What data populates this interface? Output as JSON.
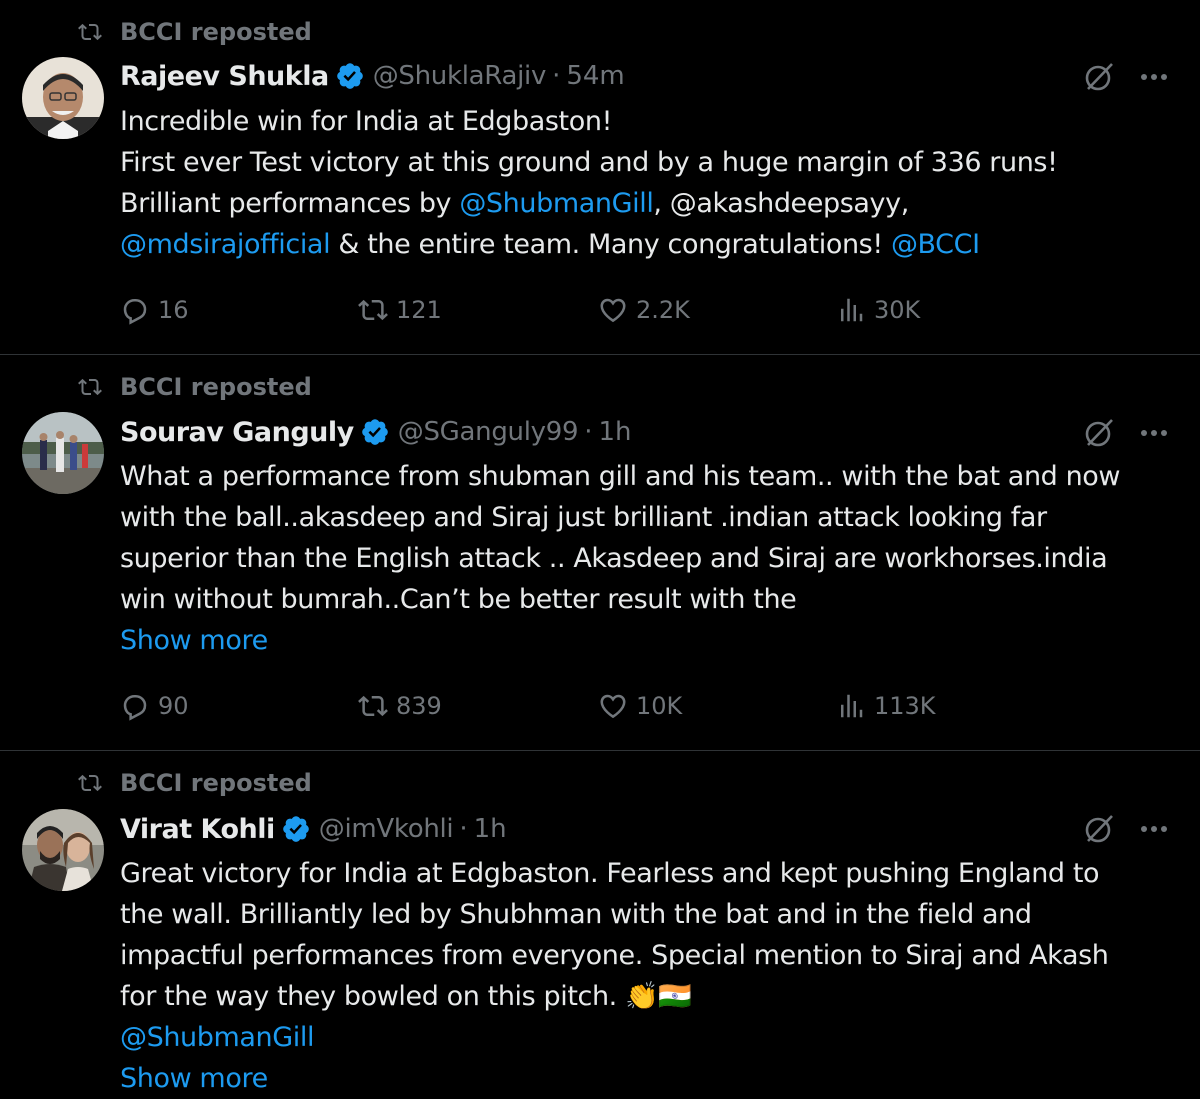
{
  "tweets": [
    {
      "repost_label": "BCCI reposted",
      "name": "Rajeev Shukla",
      "handle": "@ShuklaRajiv",
      "separator": "·",
      "time": "54m",
      "text_lines": [
        [
          {
            "t": "Incredible win for India at Edgbaston!"
          }
        ],
        [
          {
            "t": "First ever Test victory at this ground and by a huge margin of 336 runs!"
          }
        ],
        [
          {
            "t": "Brilliant performances by "
          },
          {
            "t": "@ShubmanGill",
            "link": true
          },
          {
            "t": ", @akashdeepsayy,"
          }
        ],
        [
          {
            "t": "@mdsirajofficial",
            "link": true
          },
          {
            "t": " & the entire team. Many congratulations! "
          },
          {
            "t": "@BCCI",
            "link": true
          }
        ]
      ],
      "replies": "16",
      "reposts": "121",
      "likes": "2.2K",
      "views": "30K"
    },
    {
      "repost_label": "BCCI reposted",
      "name": "Sourav Ganguly",
      "handle": "@SGanguly99",
      "separator": "·",
      "time": "1h",
      "text_lines": [
        [
          {
            "t": "What a performance from shubman gill and his team.. with the bat and now"
          }
        ],
        [
          {
            "t": "with the ball..akasdeep and Siraj just brilliant .indian attack looking far"
          }
        ],
        [
          {
            "t": "superior than the English attack .. Akasdeep and Siraj are workhorses.india"
          }
        ],
        [
          {
            "t": "win without bumrah..Can’t be better result with the"
          }
        ],
        [
          {
            "t": "Show more",
            "link": true
          }
        ]
      ],
      "replies": "90",
      "reposts": "839",
      "likes": "10K",
      "views": "113K"
    },
    {
      "repost_label": "BCCI reposted",
      "name": "Virat Kohli",
      "handle": "@imVkohli",
      "separator": "·",
      "time": "1h",
      "text_lines": [
        [
          {
            "t": "Great victory for India at Edgbaston. Fearless and kept pushing England to"
          }
        ],
        [
          {
            "t": "the wall. Brilliantly led by Shubhman with the bat and in the field and"
          }
        ],
        [
          {
            "t": "impactful performances from everyone. Special mention to Siraj and Akash"
          }
        ],
        [
          {
            "t": "for the way they bowled on this pitch. 👏🇮🇳"
          }
        ],
        [
          {
            "t": "@ShubmanGill",
            "link": true
          }
        ],
        [
          {
            "t": "Show more",
            "link": true
          }
        ]
      ]
    }
  ],
  "colors": {
    "background": "#000000",
    "text": "#e7e9ea",
    "muted": "#71767b",
    "link": "#1d9bf0",
    "verified": "#1d9bf0",
    "divider": "#2f3336"
  },
  "icons": {
    "repost": "repost-icon",
    "verified": "verified-badge-icon",
    "grok": "grok-icon",
    "more": "more-icon",
    "reply": "reply-icon",
    "like": "heart-icon",
    "views": "views-icon",
    "bookmark": "bookmark-icon",
    "share": "share-icon"
  }
}
